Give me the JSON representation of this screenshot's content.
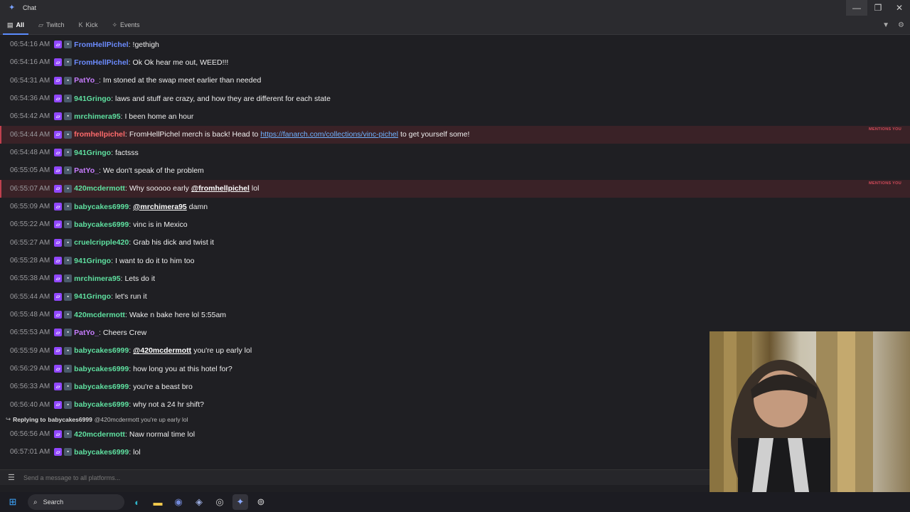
{
  "window": {
    "title": "Chat"
  },
  "tabs": [
    {
      "label": "All",
      "icon": "chat-bubble-icon",
      "active": true
    },
    {
      "label": "Twitch",
      "icon": "twitch-icon",
      "active": false
    },
    {
      "label": "Kick",
      "icon": "kick-icon",
      "active": false
    },
    {
      "label": "Events",
      "icon": "sparkle-icon",
      "active": false
    }
  ],
  "mention_label": "MENTIONS YOU",
  "messages": [
    {
      "time": "06:54:16 AM",
      "user": "FromHellPichel",
      "color": "#6c8cff",
      "text": "!gethigh"
    },
    {
      "time": "06:54:16 AM",
      "user": "FromHellPichel",
      "color": "#6c8cff",
      "text": "Ok Ok hear me out, WEED!!!"
    },
    {
      "time": "06:54:31 AM",
      "user": "PatYo_",
      "color": "#c77dff",
      "text": "Im stoned at the swap meet earlier than needed"
    },
    {
      "time": "06:54:36 AM",
      "user": "941Gringo",
      "color": "#5fe0a0",
      "text": "laws and stuff are crazy, and how they are different for each state"
    },
    {
      "time": "06:54:42 AM",
      "user": "mrchimera95",
      "color": "#5fe0a0",
      "text": "I been home an hour"
    },
    {
      "time": "06:54:44 AM",
      "user": "fromhellpichel",
      "color": "#ff6b6b",
      "text_before": "FromHellPichel merch is back! Head to",
      "link": "https://fanarch.com/collections/vinc-pichel",
      "text_after": "to get yourself some!",
      "mention": true
    },
    {
      "time": "06:54:48 AM",
      "user": "941Gringo",
      "color": "#5fe0a0",
      "text": "factsss"
    },
    {
      "time": "06:55:05 AM",
      "user": "PatYo_",
      "color": "#c77dff",
      "text": "We don't speak of the problem"
    },
    {
      "time": "06:55:07 AM",
      "user": "420mcdermott",
      "color": "#5fe0a0",
      "text_before": "Why sooooo early",
      "at": "@fromhellpichel",
      "text_after": "lol",
      "mention": true
    },
    {
      "time": "06:55:09 AM",
      "user": "babycakes6999",
      "color": "#5fe0a0",
      "at": "@mrchimera95",
      "text_after": "damn"
    },
    {
      "time": "06:55:22 AM",
      "user": "babycakes6999",
      "color": "#5fe0a0",
      "text": "vinc is in Mexico"
    },
    {
      "time": "06:55:27 AM",
      "user": "cruelcripple420",
      "color": "#5fe0a0",
      "text": "Grab his dick and twist it"
    },
    {
      "time": "06:55:28 AM",
      "user": "941Gringo",
      "color": "#5fe0a0",
      "text": "I want to do it to him too"
    },
    {
      "time": "06:55:38 AM",
      "user": "mrchimera95",
      "color": "#5fe0a0",
      "text": "Lets do it"
    },
    {
      "time": "06:55:44 AM",
      "user": "941Gringo",
      "color": "#5fe0a0",
      "text": "let's run it"
    },
    {
      "time": "06:55:48 AM",
      "user": "420mcdermott",
      "color": "#5fe0a0",
      "text": "Wake n bake here lol 5:55am"
    },
    {
      "time": "06:55:53 AM",
      "user": "PatYo_",
      "color": "#c77dff",
      "text": "Cheers Crew"
    },
    {
      "time": "06:55:59 AM",
      "user": "babycakes6999",
      "color": "#5fe0a0",
      "at": "@420mcdermott",
      "text_after": "you're up early lol"
    },
    {
      "time": "06:56:29 AM",
      "user": "babycakes6999",
      "color": "#5fe0a0",
      "text": "how long you at this hotel for?"
    },
    {
      "time": "06:56:33 AM",
      "user": "babycakes6999",
      "color": "#5fe0a0",
      "text": "you're a beast bro"
    },
    {
      "time": "06:56:40 AM",
      "user": "babycakes6999",
      "color": "#5fe0a0",
      "text": "why not a 24 hr shift?"
    }
  ],
  "reply": {
    "label": "Replying to",
    "to": "babycakes6999",
    "quote": "@420mcdermott you're up early lol"
  },
  "messages_after": [
    {
      "time": "06:56:56 AM",
      "user": "420mcdermott",
      "color": "#5fe0a0",
      "text": " Naw normal time lol"
    },
    {
      "time": "06:57:01 AM",
      "user": "babycakes6999",
      "color": "#5fe0a0",
      "text": "lol"
    }
  ],
  "input": {
    "placeholder": "Send a message to all platforms..."
  },
  "taskbar": {
    "search_label": "Search"
  }
}
